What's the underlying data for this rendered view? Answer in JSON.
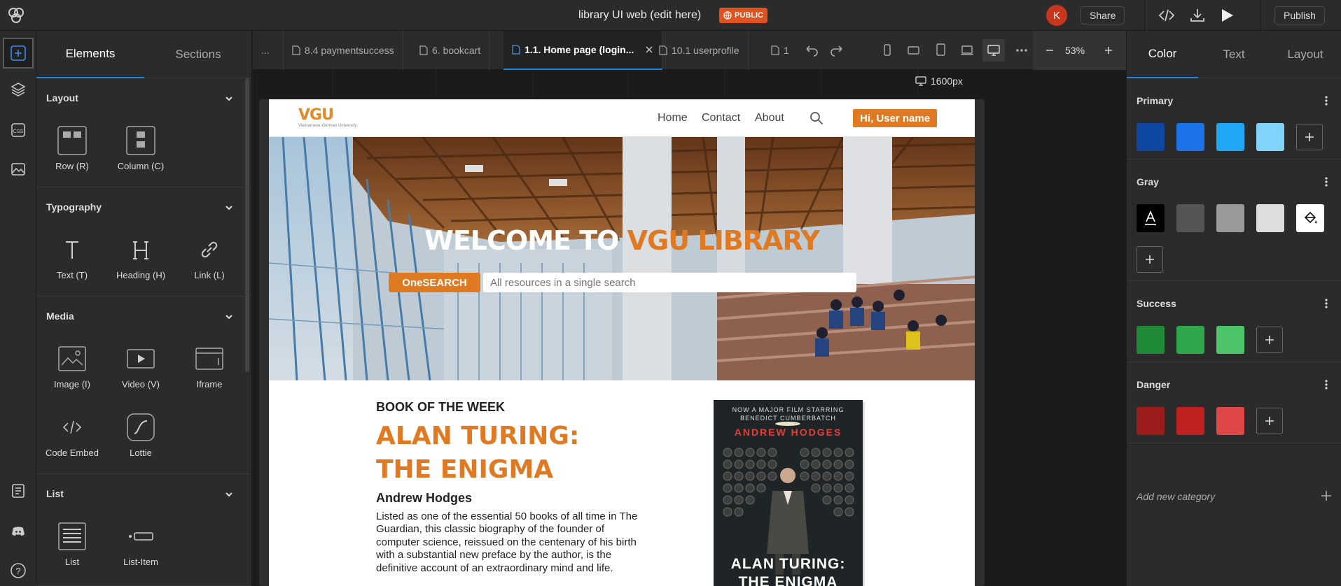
{
  "topbar": {
    "title": "library UI web (edit here)",
    "visibility_badge": "PUBLIC",
    "avatar_initial": "K",
    "share_label": "Share",
    "publish_label": "Publish"
  },
  "left_panel": {
    "tabs": [
      "Elements",
      "Sections"
    ],
    "active_tab": "Elements",
    "sections": [
      {
        "title": "Layout",
        "items": [
          "Row (R)",
          "Column (C)"
        ]
      },
      {
        "title": "Typography",
        "items": [
          "Text (T)",
          "Heading (H)",
          "Link (L)"
        ]
      },
      {
        "title": "Media",
        "items": [
          "Image (I)",
          "Video (V)",
          "Iframe",
          "Code Embed",
          "Lottie"
        ]
      },
      {
        "title": "List",
        "items": [
          "List",
          "List-Item"
        ]
      }
    ],
    "rail_icons": [
      "add-icon",
      "layers-icon",
      "css-icon",
      "image-assets-icon",
      "docs-icon",
      "discord-icon",
      "help-icon"
    ]
  },
  "file_tabs": [
    {
      "label": "...",
      "active": false
    },
    {
      "label": "8.4 paymentsuccess",
      "active": false
    },
    {
      "label": "6. bookcart",
      "active": false
    },
    {
      "label": "1.1. Home page (login...",
      "active": true
    },
    {
      "label": "10.1 userprofile",
      "active": false
    },
    {
      "label": "1",
      "active": false
    }
  ],
  "toolbar": {
    "zoom": "53%",
    "breakpoint": "1600px"
  },
  "site": {
    "logo_text": "VGU",
    "logo_subtext": "Vietnamese-German University",
    "nav_links": [
      "Home",
      "Contact",
      "About"
    ],
    "user_button": "Hi, User name",
    "hero_title_white": "WELCOME TO ",
    "hero_title_orange": "VGU LIBRARY",
    "onesearch_label": "OneSEARCH",
    "search_placeholder": "All resources in a single search",
    "book_of_week_label": "BOOK OF THE WEEK",
    "book_title_line1": "ALAN TURING:",
    "book_title_line2": "THE ENIGMA",
    "book_author": "Andrew Hodges",
    "book_description": "Listed as one of the essential 50 books of all time in The Guardian, this classic biography of the founder of computer science, reissued on the centenary of his birth with a substantial new preface by the author, is the definitive account of an extraordinary mind and life.",
    "cover_tagline": "NOW A MAJOR FILM STARRING BENEDICT CUMBERBATCH",
    "cover_author": "ANDREW HODGES",
    "cover_title_line1": "ALAN TURING:",
    "cover_title_line2": "THE ENIGMA"
  },
  "right_panel": {
    "tabs": [
      "Color",
      "Text",
      "Layout"
    ],
    "active_tab": "Color",
    "categories": [
      {
        "name": "Primary",
        "swatches": [
          "#0d47a1",
          "#1a73e8",
          "#1ea7f5",
          "#80d4fb"
        ]
      },
      {
        "name": "Gray",
        "swatches": [
          "#000000",
          "#555555",
          "#999999",
          "#dddddd",
          "#ffffff"
        ]
      },
      {
        "name": "Success",
        "swatches": [
          "#1f8a35",
          "#2ea84a",
          "#4cc46a"
        ]
      },
      {
        "name": "Danger",
        "swatches": [
          "#9c1c1c",
          "#c02222",
          "#e04848"
        ]
      }
    ],
    "add_category_label": "Add new category"
  },
  "colors": {
    "accent": "#1e88e5",
    "brand_orange": "#e07a22",
    "badge_red": "#e0531f"
  }
}
